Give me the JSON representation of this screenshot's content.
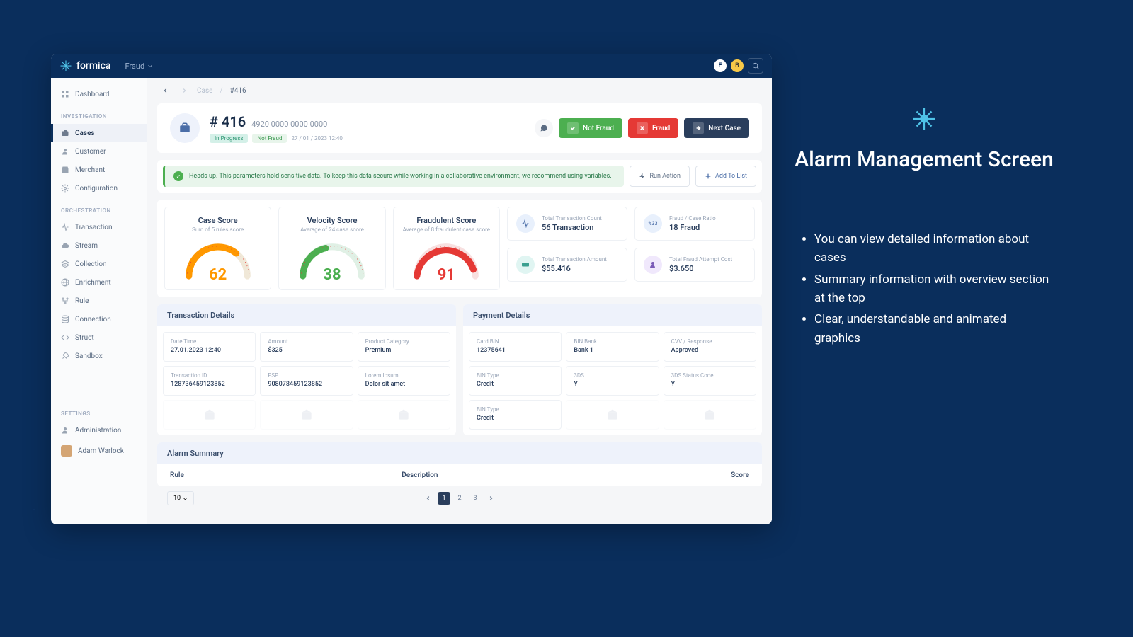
{
  "brand": "formica",
  "nav_dropdown": "Fraud",
  "avatars": {
    "e": "E",
    "b": "B"
  },
  "sidebar": {
    "dashboard": "Dashboard",
    "sec_investigation": "INVESTIGATION",
    "cases": "Cases",
    "customer": "Customer",
    "merchant": "Merchant",
    "configuration": "Configuration",
    "sec_orchestration": "ORCHESTRATION",
    "transaction": "Transaction",
    "stream": "Stream",
    "collection": "Collection",
    "enrichment": "Enrichment",
    "rule": "Rule",
    "connection": "Connection",
    "struct": "Struct",
    "sandbox": "Sandbox",
    "sec_settings": "SETTINGS",
    "administration": "Administration",
    "user_name": "Adam Warlock"
  },
  "breadcrumb": {
    "case": "Case",
    "id": "#416"
  },
  "case": {
    "id": "# 416",
    "card": "4920 0000 0000 0000",
    "tag_progress": "In Progress",
    "tag_notfraud": "Not Fraud",
    "date": "27 / 01 / 2023   12:40"
  },
  "actions": {
    "not_fraud": "Not Fraud",
    "fraud": "Fraud",
    "next_case": "Next Case",
    "run_action": "Run Action",
    "add_to_list": "Add To List"
  },
  "banner": "Heads up. This parameters hold sensitive data. To keep this data secure while working in a collaborative environment, we recommend using variables.",
  "scores": {
    "case": {
      "title": "Case Score",
      "sub": "Sum of 5 rules score",
      "value": "62"
    },
    "velocity": {
      "title": "Velocity Score",
      "sub": "Average of 24 case score",
      "value": "38"
    },
    "fraud": {
      "title": "Fraudulent Score",
      "sub": "Average of 8 fraudulent case score",
      "value": "91"
    }
  },
  "stats": {
    "count": {
      "label": "Total Transaction Count",
      "value": "56 Transaction"
    },
    "ratio": {
      "label": "Fraud / Case Ratio",
      "value": "18 Fraud",
      "pct": "%33"
    },
    "amount": {
      "label": "Total Transaction Amount",
      "value": "$55.416"
    },
    "attempt": {
      "label": "Total Fraud Attempt Cost",
      "value": "$3.650"
    }
  },
  "trans_details": {
    "title": "Transaction Details",
    "f1": {
      "label": "Date Time",
      "value": "27.01.2023  12:40"
    },
    "f2": {
      "label": "Amount",
      "value": "$325"
    },
    "f3": {
      "label": "Product Category",
      "value": "Premium"
    },
    "f4": {
      "label": "Transaction ID",
      "value": "128736459123852"
    },
    "f5": {
      "label": "PSP",
      "value": "908078459123852"
    },
    "f6": {
      "label": "Lorem Ipsum",
      "value": "Dolor sit amet"
    }
  },
  "pay_details": {
    "title": "Payment Details",
    "f1": {
      "label": "Card BIN",
      "value": "12375641"
    },
    "f2": {
      "label": "BIN Bank",
      "value": "Bank 1"
    },
    "f3": {
      "label": "CVV / Response",
      "value": "Approved"
    },
    "f4": {
      "label": "BIN Type",
      "value": "Credit"
    },
    "f5": {
      "label": "3DS",
      "value": "Y"
    },
    "f6": {
      "label": "3DS Status Code",
      "value": "Y"
    },
    "f7": {
      "label": "BIN Type",
      "value": "Credit"
    }
  },
  "alarm": {
    "title": "Alarm Summary",
    "col_rule": "Rule",
    "col_desc": "Description",
    "col_score": "Score"
  },
  "pagination": {
    "size": "10",
    "p1": "1",
    "p2": "2",
    "p3": "3"
  },
  "marketing": {
    "title": "Alarm Management Screen",
    "b1": "You can view detailed information about cases",
    "b2": "Summary information with overview section at the top",
    "b3": "Clear, understandable and animated graphics"
  }
}
